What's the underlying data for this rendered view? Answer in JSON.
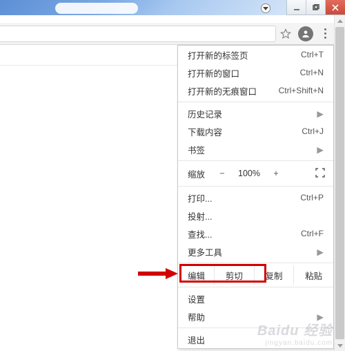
{
  "menu": {
    "new_tab": {
      "label": "打开新的标签页",
      "shortcut": "Ctrl+T"
    },
    "new_window": {
      "label": "打开新的窗口",
      "shortcut": "Ctrl+N"
    },
    "incognito": {
      "label": "打开新的无痕窗口",
      "shortcut": "Ctrl+Shift+N"
    },
    "history": {
      "label": "历史记录"
    },
    "downloads": {
      "label": "下载内容",
      "shortcut": "Ctrl+J"
    },
    "bookmarks": {
      "label": "书签"
    },
    "zoom": {
      "label": "缩放",
      "minus": "−",
      "value": "100%",
      "plus": "+"
    },
    "print": {
      "label": "打印...",
      "shortcut": "Ctrl+P"
    },
    "cast": {
      "label": "投射..."
    },
    "find": {
      "label": "查找...",
      "shortcut": "Ctrl+F"
    },
    "more_tools": {
      "label": "更多工具"
    },
    "edit": {
      "label": "编辑",
      "cut": "剪切",
      "copy": "复制",
      "paste": "粘贴"
    },
    "settings": {
      "label": "设置"
    },
    "help": {
      "label": "帮助"
    },
    "exit": {
      "label": "退出"
    }
  },
  "watermark": {
    "brand": "Baidu 经验",
    "sub": "jingyan.baidu.com"
  }
}
